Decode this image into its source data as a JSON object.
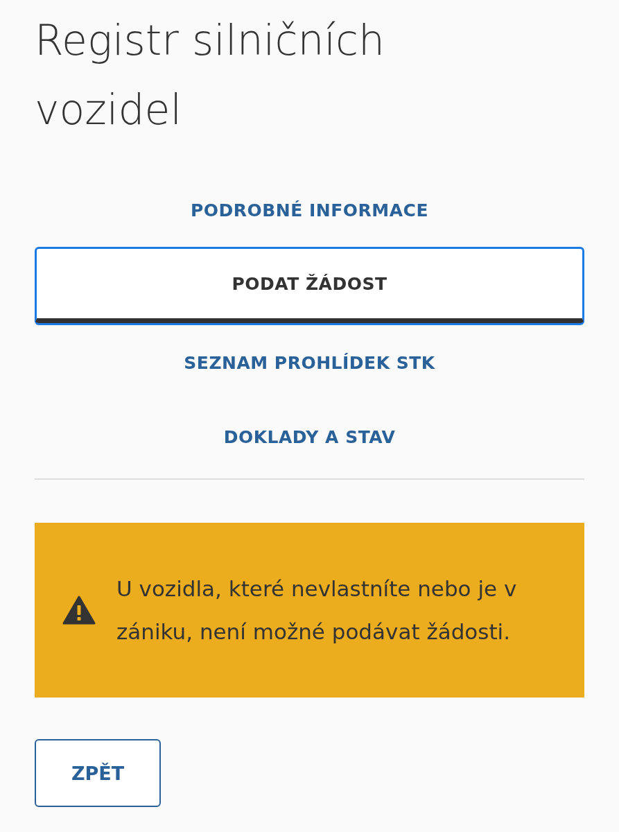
{
  "title": "Registr silničních vozidel",
  "menu": [
    {
      "label": "PODROBNÉ INFORMACE",
      "selected": false
    },
    {
      "label": "PODAT ŽÁDOST",
      "selected": true
    },
    {
      "label": "SEZNAM PROHLÍDEK STK",
      "selected": false
    },
    {
      "label": "DOKLADY A STAV",
      "selected": false
    }
  ],
  "warning": {
    "text": "U vozidla, které nevlastníte nebo je v zániku, není možné podávat žádosti."
  },
  "back_button": {
    "label": "ZPĚT"
  }
}
